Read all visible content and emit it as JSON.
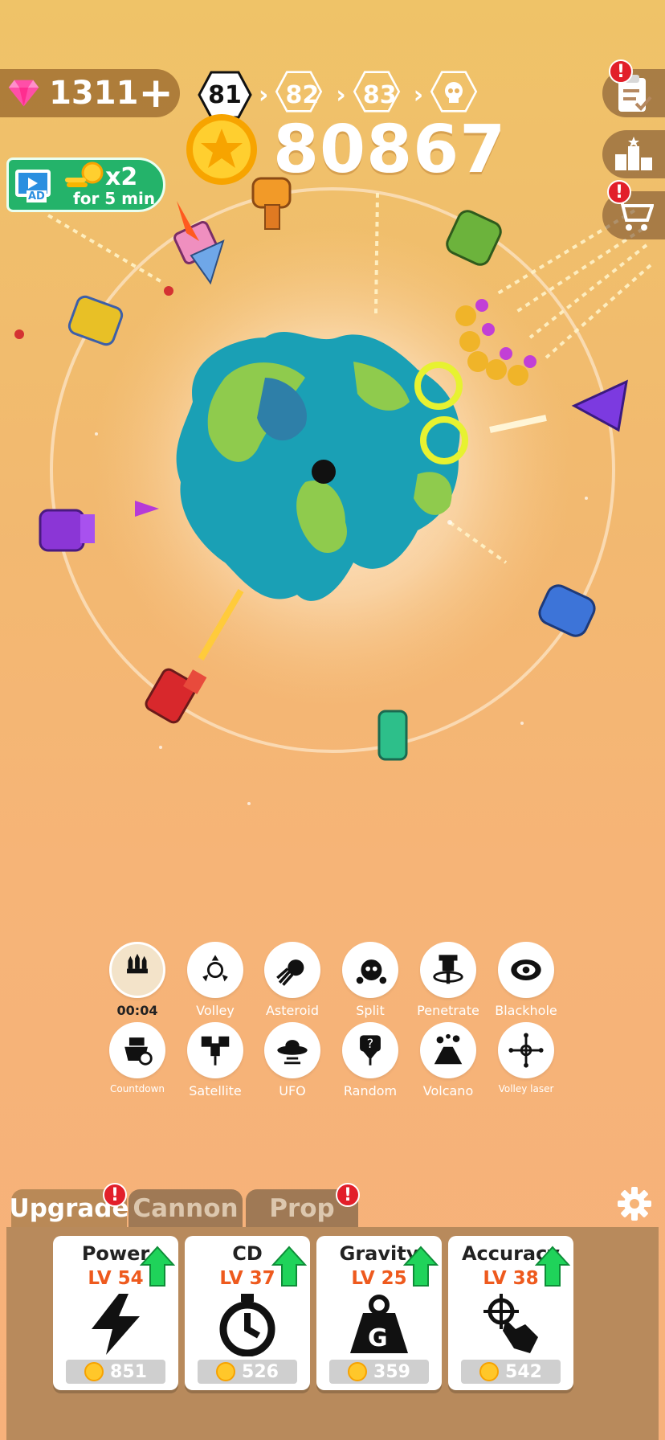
{
  "hud": {
    "gems": "1311",
    "gems_plus": "+",
    "coins": "80867",
    "levels": [
      {
        "label": "81",
        "state": "current"
      },
      {
        "label": "82",
        "state": "next"
      },
      {
        "label": "83",
        "state": "next"
      },
      {
        "label": "",
        "state": "boss",
        "icon": "skull-icon"
      }
    ],
    "side_buttons": [
      {
        "name": "tasks",
        "icon": "clipboard-icon",
        "badge": "!"
      },
      {
        "name": "ranking",
        "icon": "podium-icon",
        "badge": ""
      },
      {
        "name": "shop",
        "icon": "cart-icon",
        "badge": "!"
      }
    ],
    "ad_boost": {
      "ad_label": "AD",
      "multiplier": "x2",
      "duration": "for 5 min"
    }
  },
  "skills": [
    {
      "label": "00:04",
      "icon": "rockets-icon",
      "active": true
    },
    {
      "label": "Volley",
      "icon": "volley-icon"
    },
    {
      "label": "Asteroid",
      "icon": "asteroid-icon"
    },
    {
      "label": "Split",
      "icon": "split-icon"
    },
    {
      "label": "Penetrate",
      "icon": "penetrate-icon"
    },
    {
      "label": "Blackhole",
      "icon": "blackhole-icon"
    },
    {
      "label": "Countdown",
      "icon": "countdown-icon"
    },
    {
      "label": "Satellite",
      "icon": "satellite-icon"
    },
    {
      "label": "UFO",
      "icon": "ufo-icon"
    },
    {
      "label": "Random",
      "icon": "random-icon"
    },
    {
      "label": "Volcano",
      "icon": "volcano-icon"
    },
    {
      "label": "Volley laser",
      "icon": "volley-laser-icon"
    }
  ],
  "tabs": [
    {
      "label": "Upgrade",
      "active": true,
      "badge": "!"
    },
    {
      "label": "Cannon",
      "active": false,
      "badge": ""
    },
    {
      "label": "Prop",
      "active": false,
      "badge": "!"
    }
  ],
  "upgrades": [
    {
      "name": "Power",
      "level": "LV 54",
      "price": "851",
      "icon": "lightning-icon"
    },
    {
      "name": "CD",
      "level": "LV 37",
      "price": "526",
      "icon": "stopwatch-icon"
    },
    {
      "name": "Gravity",
      "level": "LV 25",
      "price": "359",
      "icon": "weight-icon",
      "weight_letter": "G"
    },
    {
      "name": "Accuracy",
      "level": "LV 38",
      "price": "542",
      "icon": "aim-hand-icon"
    }
  ],
  "colors": {
    "accent_green": "#1fd35a",
    "level_orange": "#ee5a1e",
    "badge_red": "#e21f2a"
  }
}
